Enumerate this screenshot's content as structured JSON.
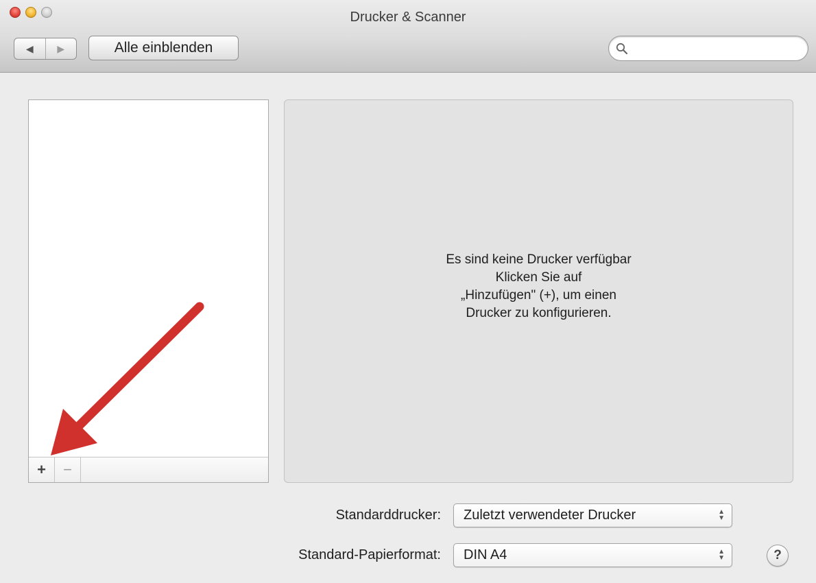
{
  "window": {
    "title": "Drucker & Scanner"
  },
  "toolbar": {
    "back_symbol": "◀",
    "forward_symbol": "▶",
    "show_all_label": "Alle einblenden",
    "search_placeholder": "",
    "search_value": ""
  },
  "printer_list": {
    "items": [],
    "add_label": "+",
    "remove_label": "−"
  },
  "detail": {
    "message_lines": [
      "Es sind keine Drucker verfügbar",
      "Klicken Sie auf",
      "„Hinzufügen\" (+), um einen",
      "Drucker zu konfigurieren."
    ]
  },
  "settings": {
    "default_printer_label": "Standarddrucker:",
    "default_printer_value": "Zuletzt verwendeter Drucker",
    "paper_size_label": "Standard-Papierformat:",
    "paper_size_value": "DIN A4",
    "help_label": "?"
  },
  "colors": {
    "annotation_arrow": "#d0312d",
    "window_background": "#ececec",
    "detail_background": "#e3e3e3"
  },
  "icons": {
    "search": "magnifier-icon",
    "popup": "up-down-chevron-icon"
  }
}
